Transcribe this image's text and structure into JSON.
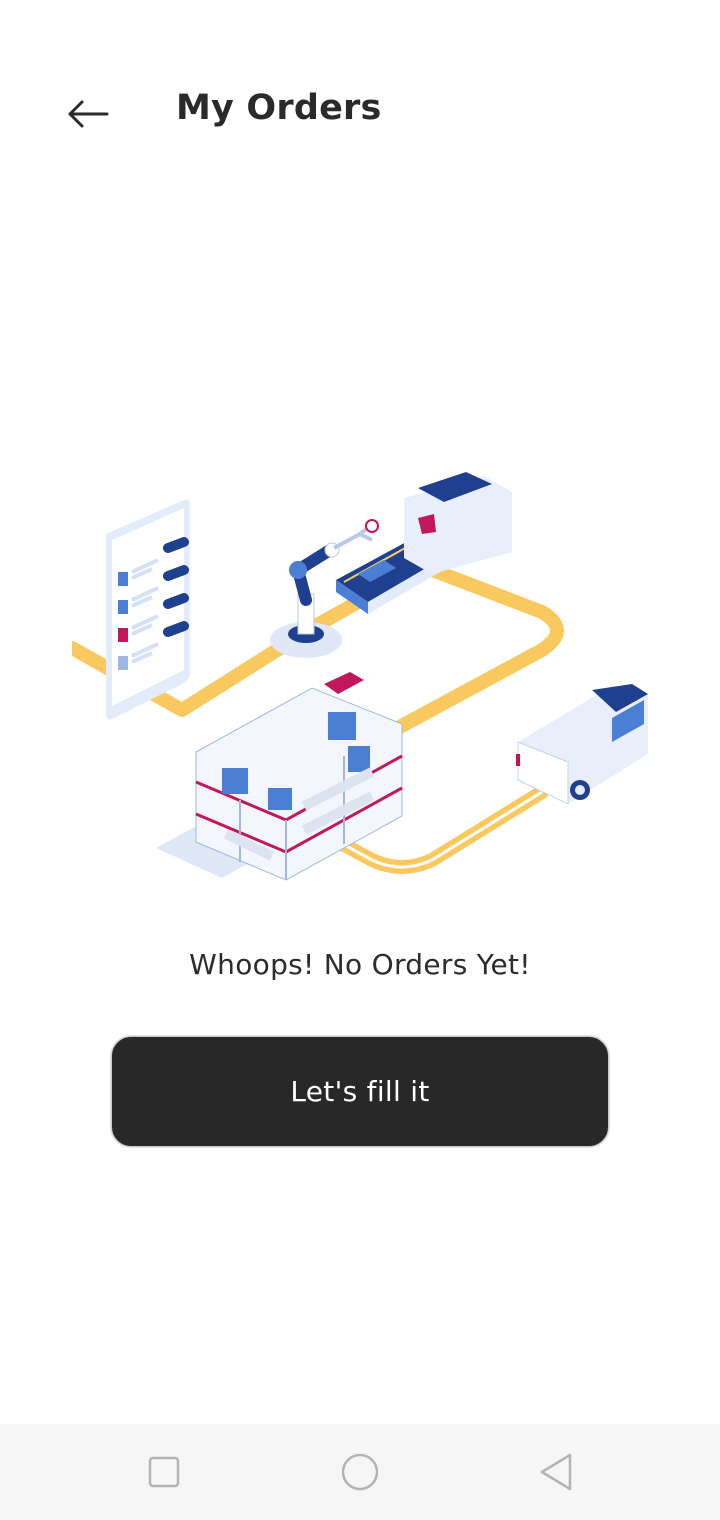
{
  "header": {
    "title": "My Orders",
    "back_icon": "arrow-left-icon"
  },
  "empty_state": {
    "illustration": "warehouse-logistics-illustration",
    "message": "Whoops! No Orders Yet!",
    "button_label": "Let's fill it"
  },
  "system_nav": {
    "recents_icon": "square-icon",
    "home_icon": "circle-icon",
    "back_icon": "triangle-back-icon"
  },
  "colors": {
    "title_text": "#2a2a2a",
    "button_bg": "#282828",
    "button_text": "#ffffff",
    "track_yellow": "#f9c95f",
    "brand_blue": "#1f3f8f",
    "accent_magenta": "#c2185b",
    "navbar_bg": "#f6f6f6"
  }
}
